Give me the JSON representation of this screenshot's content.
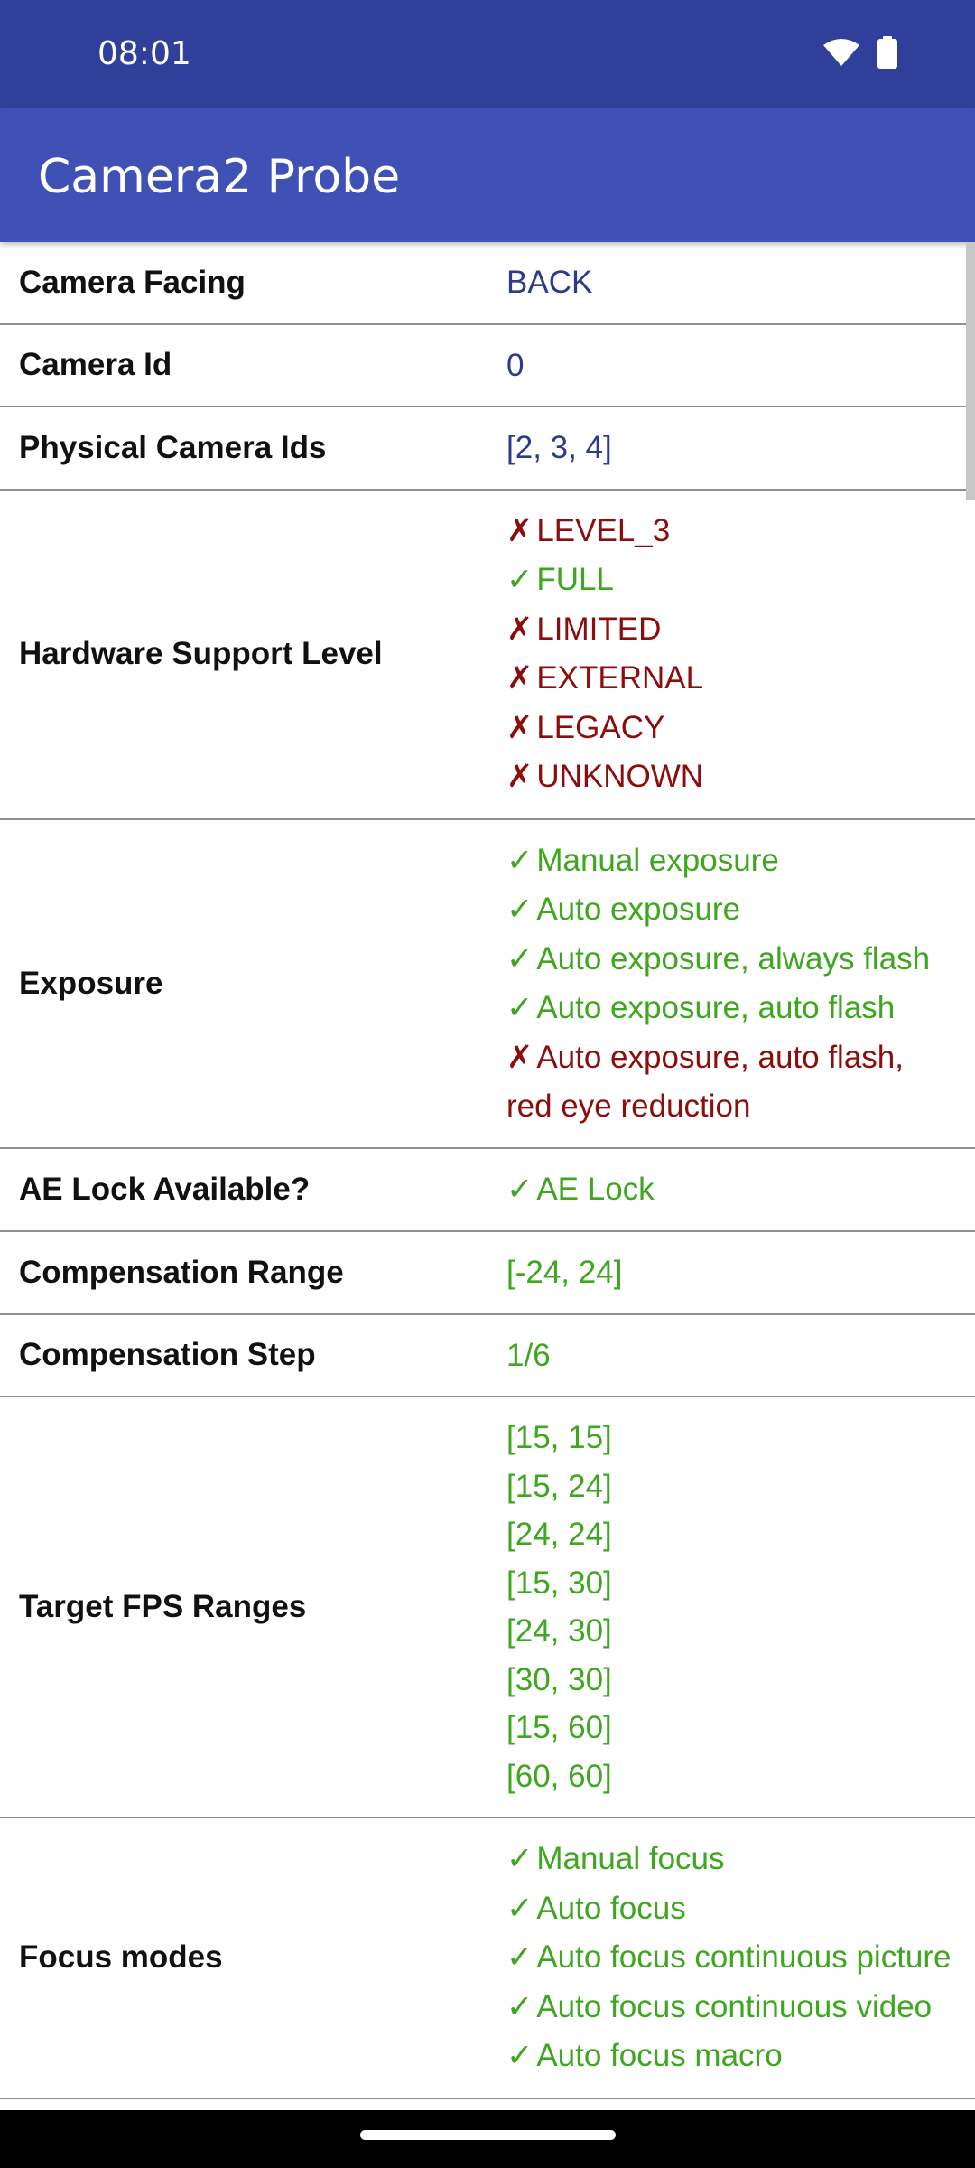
{
  "status_bar": {
    "time": "08:01",
    "icons": [
      "wifi-icon",
      "battery-icon"
    ],
    "background": "#30409a"
  },
  "app_bar": {
    "title": "Camera2 Probe",
    "background": "#4051b5"
  },
  "colors": {
    "value_blue": "#2e3a8c",
    "supported_green": "#3ea61f",
    "unsupported_red": "#8b0d0d"
  },
  "symbols": {
    "check": "✓",
    "cross": "✗"
  },
  "rows": [
    {
      "label": "Camera Facing",
      "color": "blue",
      "values": [
        {
          "text": "BACK"
        }
      ]
    },
    {
      "label": "Camera Id",
      "color": "blue",
      "values": [
        {
          "text": "0"
        }
      ]
    },
    {
      "label": "Physical Camera Ids",
      "color": "blue",
      "values": [
        {
          "text": "[2, 3, 4]"
        }
      ]
    },
    {
      "label": "Hardware Support Level",
      "values": [
        {
          "status": "cross",
          "text": "LEVEL_3"
        },
        {
          "status": "check",
          "text": "FULL"
        },
        {
          "status": "cross",
          "text": "LIMITED"
        },
        {
          "status": "cross",
          "text": "EXTERNAL"
        },
        {
          "status": "cross",
          "text": "LEGACY"
        },
        {
          "status": "cross",
          "text": "UNKNOWN"
        }
      ]
    },
    {
      "label": "Exposure",
      "values": [
        {
          "status": "check",
          "text": "Manual exposure"
        },
        {
          "status": "check",
          "text": "Auto exposure"
        },
        {
          "status": "check",
          "text": "Auto exposure, always flash"
        },
        {
          "status": "check",
          "text": "Auto exposure, auto flash"
        },
        {
          "status": "cross",
          "text": "Auto exposure, auto flash, red eye reduction"
        }
      ]
    },
    {
      "label": "AE Lock Available?",
      "values": [
        {
          "status": "check",
          "text": "AE Lock"
        }
      ]
    },
    {
      "label": "Compensation Range",
      "color": "green",
      "values": [
        {
          "text": "[-24, 24]"
        }
      ]
    },
    {
      "label": "Compensation Step",
      "color": "green",
      "values": [
        {
          "text": "1/6"
        }
      ]
    },
    {
      "label": "Target FPS Ranges",
      "color": "green",
      "values": [
        {
          "text": "[15, 15]"
        },
        {
          "text": "[15, 24]"
        },
        {
          "text": "[24, 24]"
        },
        {
          "text": "[15, 30]"
        },
        {
          "text": "[24, 30]"
        },
        {
          "text": "[30, 30]"
        },
        {
          "text": "[15, 60]"
        },
        {
          "text": "[60, 60]"
        }
      ]
    },
    {
      "label": "Focus modes",
      "values": [
        {
          "status": "check",
          "text": "Manual focus"
        },
        {
          "status": "check",
          "text": "Auto focus"
        },
        {
          "status": "check",
          "text": "Auto focus continuous picture"
        },
        {
          "status": "check",
          "text": "Auto focus continuous video"
        },
        {
          "status": "check",
          "text": "Auto focus macro"
        }
      ]
    }
  ]
}
